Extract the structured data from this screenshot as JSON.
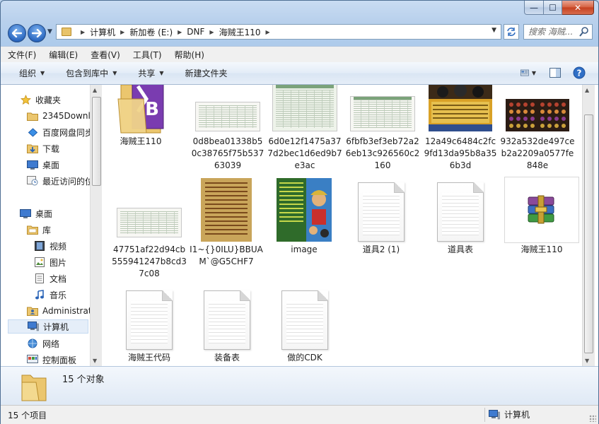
{
  "window": {
    "caption": {
      "minimize": "—",
      "maximize": "☐",
      "close": "✕"
    }
  },
  "address": {
    "breadcrumbs": [
      "计算机",
      "新加卷 (E:)",
      "DNF",
      "海贼王110"
    ]
  },
  "search": {
    "placeholder": "搜索 海贼..."
  },
  "menubar": [
    "文件(F)",
    "编辑(E)",
    "查看(V)",
    "工具(T)",
    "帮助(H)"
  ],
  "toolbar": {
    "organize": "组织",
    "include_in_library": "包含到库中",
    "share": "共享",
    "new_folder": "新建文件夹"
  },
  "sidebar": {
    "favorites": {
      "label": "收藏夹",
      "items": [
        "2345Downl",
        "百度网盘同步",
        "下载",
        "桌面",
        "最近访问的位"
      ]
    },
    "desktop": {
      "label": "桌面"
    },
    "libraries": {
      "label": "库",
      "items": [
        "视频",
        "图片",
        "文档",
        "音乐"
      ]
    },
    "others": [
      "Administrat",
      "计算机",
      "网络",
      "控制面板"
    ]
  },
  "files": [
    {
      "name": "海贼王110",
      "type": "folder"
    },
    {
      "name": "0d8bea01338b50c38765f75b53763039",
      "type": "sheet-wide"
    },
    {
      "name": "6d0e12f1475a377d2bec1d6ed9b7e3ac",
      "type": "sheet-tall"
    },
    {
      "name": "6fbfb3ef3eb72a26eb13c926560c2160",
      "type": "sheet-mid"
    },
    {
      "name": "12a49c6484c2fc9fd13da95b8a356b3d",
      "type": "poster"
    },
    {
      "name": "932a532de497ceb2a2209a0577fe848e",
      "type": "grid"
    },
    {
      "name": "47751af22d94cb555941247b8cd37c08",
      "type": "sheet-wide"
    },
    {
      "name": "I1~{}0ILU}BBUAM`@G5CHF7",
      "type": "list-image"
    },
    {
      "name": "image",
      "type": "anime-image"
    },
    {
      "name": "道具2 (1)",
      "type": "doc"
    },
    {
      "name": "道具表",
      "type": "doc"
    },
    {
      "name": "海贼王110",
      "type": "rar"
    },
    {
      "name": "海贼王代码",
      "type": "doc"
    },
    {
      "name": "装备表",
      "type": "doc"
    },
    {
      "name": "做的CDK",
      "type": "doc"
    }
  ],
  "details": {
    "count_text": "15 个对象"
  },
  "status": {
    "left": "15 个项目",
    "right": "计算机"
  },
  "colors": {
    "accent": "#2b68c1",
    "folder": "#e8c36a",
    "selection": "#e5eef9"
  }
}
